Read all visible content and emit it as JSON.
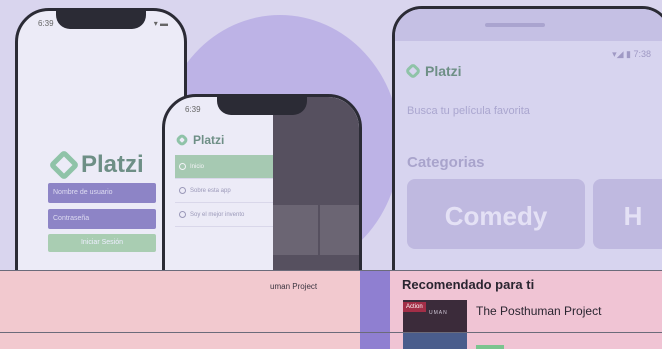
{
  "phone_login": {
    "time": "6:39",
    "status": "▾ ▬",
    "brand": "Platzi",
    "user_placeholder": "Nombre de usuario",
    "password_placeholder": "Contraseña",
    "login_button": "Iniciar Sesión"
  },
  "phone_menu": {
    "time": "6:39",
    "brand": "Platzi",
    "items": [
      {
        "label": "Inicio"
      },
      {
        "label": "Sobre esta app"
      },
      {
        "label": "Soy el mejor invento"
      }
    ],
    "behind_text": "uman Project"
  },
  "phone_home": {
    "status": "▾◢ ▮ 7:38",
    "brand": "Platzi",
    "search_placeholder": "Busca tu película favorita",
    "categories_title": "Categorias",
    "category_main": "Comedy",
    "category_side": "H",
    "recommended_title": "Recomendado para ti",
    "poster_badge": "Action",
    "poster_text": "UMAN",
    "movie_title": "The Posthuman Project"
  }
}
